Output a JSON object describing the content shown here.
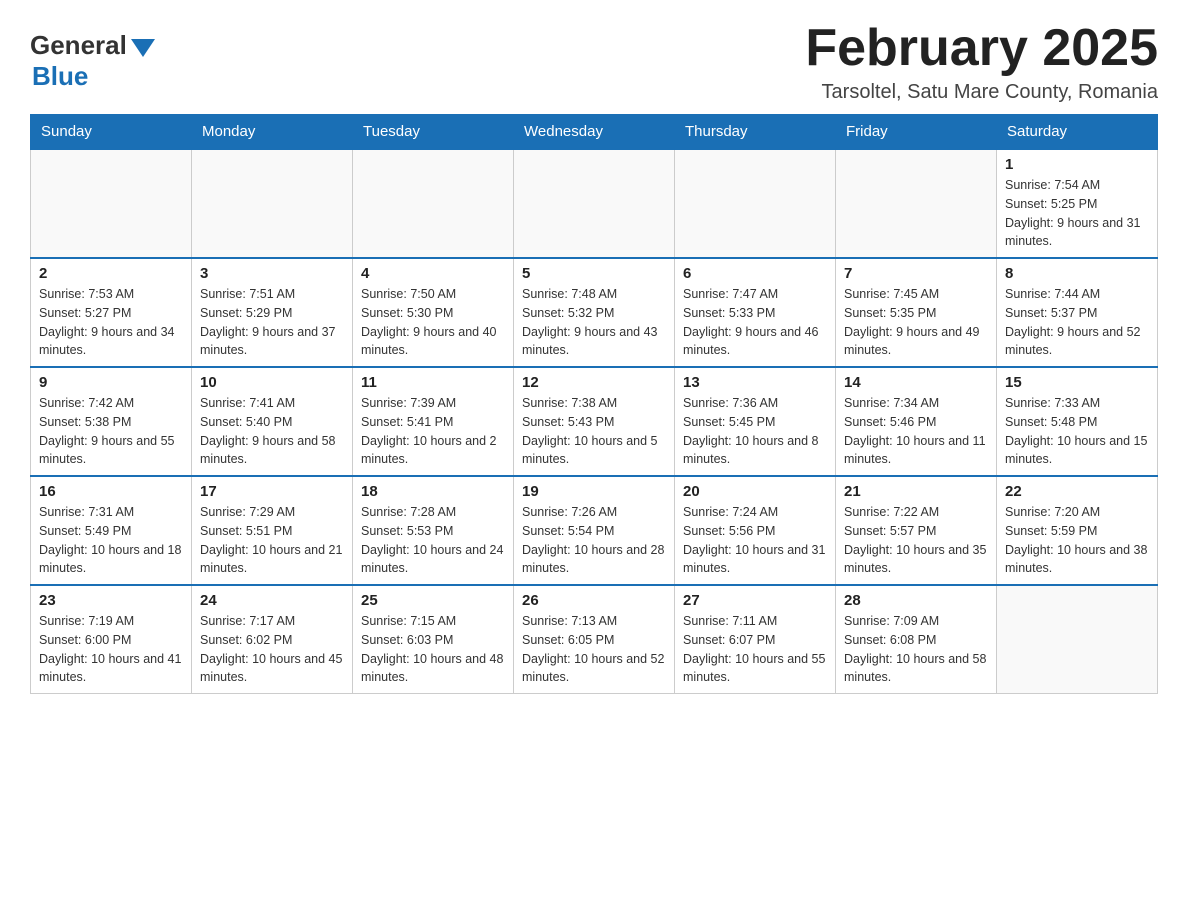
{
  "logo": {
    "general": "General",
    "blue": "Blue"
  },
  "title": "February 2025",
  "subtitle": "Tarsoltel, Satu Mare County, Romania",
  "days_of_week": [
    "Sunday",
    "Monday",
    "Tuesday",
    "Wednesday",
    "Thursday",
    "Friday",
    "Saturday"
  ],
  "weeks": [
    {
      "days": [
        {
          "number": "",
          "info": ""
        },
        {
          "number": "",
          "info": ""
        },
        {
          "number": "",
          "info": ""
        },
        {
          "number": "",
          "info": ""
        },
        {
          "number": "",
          "info": ""
        },
        {
          "number": "",
          "info": ""
        },
        {
          "number": "1",
          "info": "Sunrise: 7:54 AM\nSunset: 5:25 PM\nDaylight: 9 hours and 31 minutes."
        }
      ]
    },
    {
      "days": [
        {
          "number": "2",
          "info": "Sunrise: 7:53 AM\nSunset: 5:27 PM\nDaylight: 9 hours and 34 minutes."
        },
        {
          "number": "3",
          "info": "Sunrise: 7:51 AM\nSunset: 5:29 PM\nDaylight: 9 hours and 37 minutes."
        },
        {
          "number": "4",
          "info": "Sunrise: 7:50 AM\nSunset: 5:30 PM\nDaylight: 9 hours and 40 minutes."
        },
        {
          "number": "5",
          "info": "Sunrise: 7:48 AM\nSunset: 5:32 PM\nDaylight: 9 hours and 43 minutes."
        },
        {
          "number": "6",
          "info": "Sunrise: 7:47 AM\nSunset: 5:33 PM\nDaylight: 9 hours and 46 minutes."
        },
        {
          "number": "7",
          "info": "Sunrise: 7:45 AM\nSunset: 5:35 PM\nDaylight: 9 hours and 49 minutes."
        },
        {
          "number": "8",
          "info": "Sunrise: 7:44 AM\nSunset: 5:37 PM\nDaylight: 9 hours and 52 minutes."
        }
      ]
    },
    {
      "days": [
        {
          "number": "9",
          "info": "Sunrise: 7:42 AM\nSunset: 5:38 PM\nDaylight: 9 hours and 55 minutes."
        },
        {
          "number": "10",
          "info": "Sunrise: 7:41 AM\nSunset: 5:40 PM\nDaylight: 9 hours and 58 minutes."
        },
        {
          "number": "11",
          "info": "Sunrise: 7:39 AM\nSunset: 5:41 PM\nDaylight: 10 hours and 2 minutes."
        },
        {
          "number": "12",
          "info": "Sunrise: 7:38 AM\nSunset: 5:43 PM\nDaylight: 10 hours and 5 minutes."
        },
        {
          "number": "13",
          "info": "Sunrise: 7:36 AM\nSunset: 5:45 PM\nDaylight: 10 hours and 8 minutes."
        },
        {
          "number": "14",
          "info": "Sunrise: 7:34 AM\nSunset: 5:46 PM\nDaylight: 10 hours and 11 minutes."
        },
        {
          "number": "15",
          "info": "Sunrise: 7:33 AM\nSunset: 5:48 PM\nDaylight: 10 hours and 15 minutes."
        }
      ]
    },
    {
      "days": [
        {
          "number": "16",
          "info": "Sunrise: 7:31 AM\nSunset: 5:49 PM\nDaylight: 10 hours and 18 minutes."
        },
        {
          "number": "17",
          "info": "Sunrise: 7:29 AM\nSunset: 5:51 PM\nDaylight: 10 hours and 21 minutes."
        },
        {
          "number": "18",
          "info": "Sunrise: 7:28 AM\nSunset: 5:53 PM\nDaylight: 10 hours and 24 minutes."
        },
        {
          "number": "19",
          "info": "Sunrise: 7:26 AM\nSunset: 5:54 PM\nDaylight: 10 hours and 28 minutes."
        },
        {
          "number": "20",
          "info": "Sunrise: 7:24 AM\nSunset: 5:56 PM\nDaylight: 10 hours and 31 minutes."
        },
        {
          "number": "21",
          "info": "Sunrise: 7:22 AM\nSunset: 5:57 PM\nDaylight: 10 hours and 35 minutes."
        },
        {
          "number": "22",
          "info": "Sunrise: 7:20 AM\nSunset: 5:59 PM\nDaylight: 10 hours and 38 minutes."
        }
      ]
    },
    {
      "days": [
        {
          "number": "23",
          "info": "Sunrise: 7:19 AM\nSunset: 6:00 PM\nDaylight: 10 hours and 41 minutes."
        },
        {
          "number": "24",
          "info": "Sunrise: 7:17 AM\nSunset: 6:02 PM\nDaylight: 10 hours and 45 minutes."
        },
        {
          "number": "25",
          "info": "Sunrise: 7:15 AM\nSunset: 6:03 PM\nDaylight: 10 hours and 48 minutes."
        },
        {
          "number": "26",
          "info": "Sunrise: 7:13 AM\nSunset: 6:05 PM\nDaylight: 10 hours and 52 minutes."
        },
        {
          "number": "27",
          "info": "Sunrise: 7:11 AM\nSunset: 6:07 PM\nDaylight: 10 hours and 55 minutes."
        },
        {
          "number": "28",
          "info": "Sunrise: 7:09 AM\nSunset: 6:08 PM\nDaylight: 10 hours and 58 minutes."
        },
        {
          "number": "",
          "info": ""
        }
      ]
    }
  ]
}
